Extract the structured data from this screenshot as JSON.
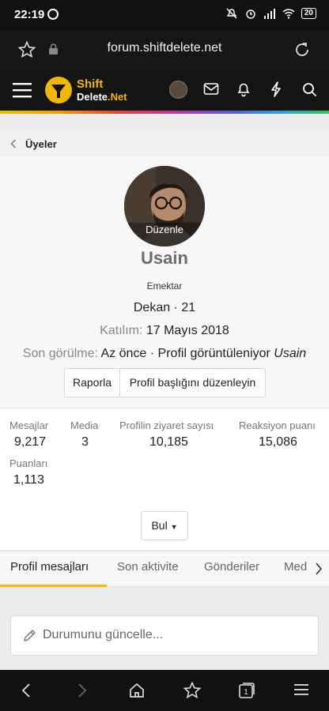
{
  "statusbar": {
    "time": "22:19",
    "battery": "20"
  },
  "browser": {
    "url": "forum.shiftdelete.net"
  },
  "site": {
    "logo_top": "Shift",
    "logo_bottom": "Delete",
    "logo_suffix": ".Net"
  },
  "breadcrumb": {
    "label": "Üyeler"
  },
  "profile": {
    "edit_overlay": "Düzenle",
    "username": "Usain",
    "title": "Emektar",
    "role_line": "Dekan · 21",
    "joined_label": "Katılım:",
    "joined_value": "17 Mayıs 2018",
    "last_seen_label": "Son görülme:",
    "last_seen_value": "Az önce · Profil görüntüleniyor",
    "last_seen_user": "Usain",
    "report_button": "Raporla",
    "edit_header_button": "Profil başlığını düzenleyin"
  },
  "stats": [
    {
      "label": "Mesajlar",
      "value": "9,217"
    },
    {
      "label": "Media",
      "value": "3"
    },
    {
      "label": "Profilin ziyaret sayısı",
      "value": "10,185"
    },
    {
      "label": "Reaksiyon puanı",
      "value": "15,086"
    },
    {
      "label": "Puanları",
      "value": "1,113"
    }
  ],
  "find_button": "Bul",
  "tabs": [
    {
      "label": "Profil mesajları",
      "active": true
    },
    {
      "label": "Son aktivite"
    },
    {
      "label": "Gönderiler"
    },
    {
      "label": "Medya"
    }
  ],
  "status_input": {
    "placeholder": "Durumunu güncelle..."
  },
  "colors": {
    "accent": "#f2b705",
    "header_bg": "#141414"
  }
}
